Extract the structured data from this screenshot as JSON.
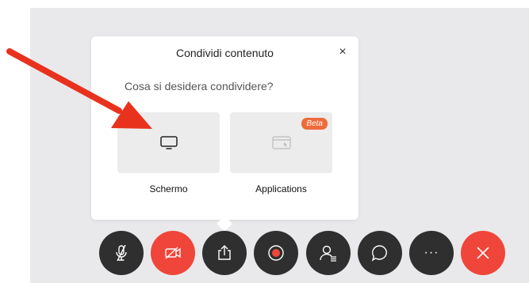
{
  "dialog": {
    "title": "Condividi contenuto",
    "close_label": "×",
    "question": "Cosa si desidera condividere?",
    "options": [
      {
        "label": "Schermo",
        "icon": "monitor-icon"
      },
      {
        "label": "Applications",
        "icon": "application-window-icon",
        "badge": "Beta"
      }
    ]
  },
  "toolbar": {
    "more_label": "···",
    "buttons": [
      {
        "name": "mute-microphone",
        "icon": "microphone-off-icon",
        "color": "#2f2f30"
      },
      {
        "name": "stop-video",
        "icon": "video-off-icon",
        "color": "#f0453a"
      },
      {
        "name": "share-content",
        "icon": "share-upload-icon",
        "color": "#2f2f30"
      },
      {
        "name": "record",
        "icon": "record-icon",
        "color": "#2f2f30"
      },
      {
        "name": "participants",
        "icon": "participants-icon",
        "color": "#2f2f30"
      },
      {
        "name": "chat",
        "icon": "chat-bubble-icon",
        "color": "#2f2f30"
      },
      {
        "name": "more-options",
        "icon": "more-horizontal-icon",
        "color": "#2f2f30"
      },
      {
        "name": "leave-meeting",
        "icon": "close-x-icon",
        "color": "#f0453a"
      }
    ]
  },
  "colors": {
    "accent_red": "#f0453a",
    "beta_orange": "#ef6b3a",
    "annotation_arrow": "#e8321e",
    "toolbar_dark": "#2f2f30",
    "background": "#e9e9eb"
  }
}
